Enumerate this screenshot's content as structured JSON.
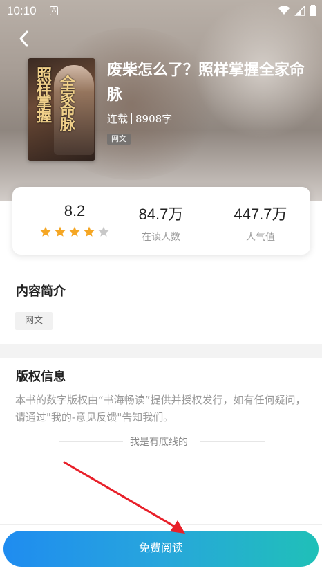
{
  "status_bar": {
    "time": "10:10",
    "indicator": "A"
  },
  "book": {
    "title": "废柴怎么了？照样掌握全家命脉",
    "status": "连载",
    "word_count": "8908字",
    "tag": "网文",
    "cover_text_1": "照样掌握",
    "cover_text_2": "全家命脉"
  },
  "stats": {
    "rating": "8.2",
    "rating_stars": 4,
    "rating_max": 5,
    "readers_value": "84.7万",
    "readers_label": "在读人数",
    "popularity_value": "447.7万",
    "popularity_label": "人气值"
  },
  "intro": {
    "title": "内容简介",
    "tag": "网文"
  },
  "copyright": {
    "title": "版权信息",
    "text": "本书的数字版权由“书海畅读”提供并授权发行，如有任何疑问，请通过\"我的-意见反馈\"告知我们。"
  },
  "end_text": "我是有底线的",
  "button": {
    "label": "免费阅读"
  },
  "colors": {
    "star_on": "#f5a623",
    "star_off": "#c8c8c8",
    "button_start": "#1f8cf0",
    "button_end": "#20c0b8",
    "annotation_arrow": "#e8202a"
  }
}
